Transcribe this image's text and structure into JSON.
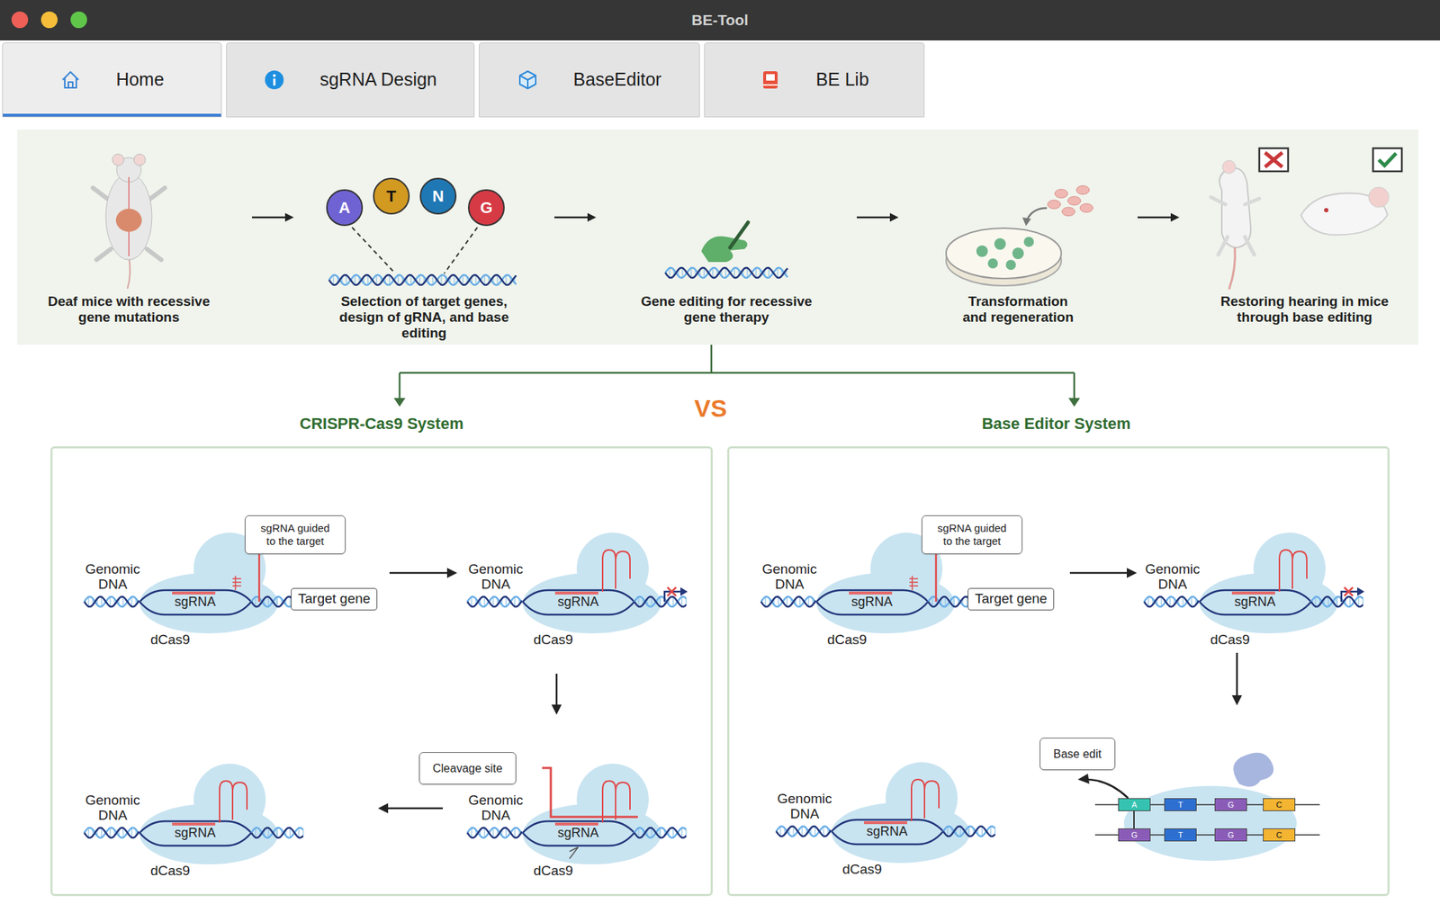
{
  "window": {
    "title": "BE-Tool"
  },
  "tabs": [
    {
      "label": "Home",
      "selected": true
    },
    {
      "label": "sgRNA Design",
      "selected": false
    },
    {
      "label": "BaseEditor",
      "selected": false
    },
    {
      "label": "BE Lib",
      "selected": false
    }
  ],
  "workflow": [
    {
      "kind": "mouse",
      "caption": "Deaf mice with recessive gene mutations"
    },
    {
      "kind": "design",
      "caption": "Selection of target genes, design of gRNA, and base editing",
      "bases": [
        {
          "label": "A",
          "color": "#6f63d3"
        },
        {
          "label": "T",
          "color": "#d39a22"
        },
        {
          "label": "N",
          "color": "#1f78b4"
        },
        {
          "label": "G",
          "color": "#d63a45"
        }
      ]
    },
    {
      "kind": "editing",
      "caption": "Gene editing for recessive gene therapy"
    },
    {
      "kind": "culture",
      "caption": "Transformation and regeneration"
    },
    {
      "kind": "restore",
      "caption": "Restoring hearing in mice through base editing"
    }
  ],
  "comparison": {
    "label": "VS"
  },
  "systems": [
    {
      "kind": "cas9",
      "title": "CRISPR-Cas9 System",
      "steps": [
        {
          "kind": "bound",
          "genomic": "Genomic DNA",
          "guide": "sgRNA",
          "protein": "dCas9",
          "callout": "sgRNA guided to the target",
          "target": "Target gene"
        },
        {
          "kind": "blocked",
          "genomic": "Genomic DNA",
          "guide": "sgRNA",
          "protein": "dCas9"
        },
        {
          "kind": "cleaving",
          "genomic": "Genomic DNA",
          "guide": "sgRNA",
          "protein": "dCas9",
          "callout": "Cleavage site"
        },
        {
          "kind": "released",
          "genomic": "Genomic DNA",
          "guide": "sgRNA",
          "protein": "dCas9"
        }
      ]
    },
    {
      "kind": "base-editor",
      "title": "Base Editor System",
      "steps": [
        {
          "kind": "bound",
          "genomic": "Genomic DNA",
          "guide": "sgRNA",
          "protein": "dCas9",
          "callout": "sgRNA guided to the target",
          "target": "Target gene"
        },
        {
          "kind": "blocked",
          "genomic": "Genomic DNA",
          "guide": "sgRNA",
          "protein": "dCas9"
        },
        {
          "kind": "base-edit",
          "callout": "Base edit",
          "top": [
            {
              "label": "A",
              "color": "#35c2b0"
            },
            {
              "label": "T",
              "color": "#2d6fd0"
            },
            {
              "label": "G",
              "color": "#8a5cb8"
            },
            {
              "label": "C",
              "color": "#f2b431"
            }
          ],
          "bottom": [
            {
              "label": "G",
              "color": "#8a5cb8"
            },
            {
              "label": "T",
              "color": "#2d6fd0"
            },
            {
              "label": "G",
              "color": "#8a5cb8"
            },
            {
              "label": "C",
              "color": "#f2b431"
            }
          ]
        },
        {
          "kind": "released",
          "genomic": "Genomic DNA",
          "guide": "sgRNA",
          "protein": "dCas9"
        }
      ]
    }
  ]
}
